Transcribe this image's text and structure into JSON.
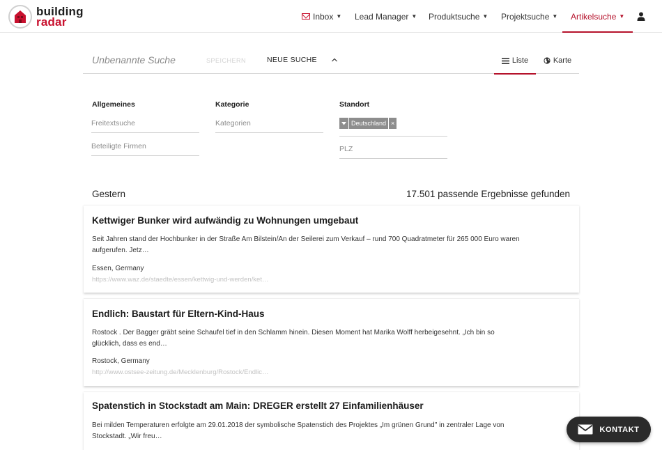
{
  "brand": {
    "line1": "building",
    "line2": "radar",
    "colors": {
      "red": "#c8102e",
      "accent": "#b5122b",
      "dark": "#2b2b2b"
    }
  },
  "nav": {
    "items": [
      {
        "label": "Inbox",
        "icon": "envelope-icon"
      },
      {
        "label": "Lead Manager"
      },
      {
        "label": "Produktsuche"
      },
      {
        "label": "Projektsuche"
      },
      {
        "label": "Artikelsuche",
        "active": true
      }
    ],
    "user_icon": "user-icon"
  },
  "search": {
    "title": "Unbenannte Suche",
    "save_label": "SPEICHERN",
    "new_label": "NEUE SUCHE",
    "views": {
      "list": "Liste",
      "map": "Karte"
    }
  },
  "filters": {
    "general": {
      "title": "Allgemeines",
      "freetext_placeholder": "Freitextsuche",
      "companies_placeholder": "Beteiligte Firmen"
    },
    "category": {
      "title": "Kategorie",
      "placeholder": "Kategorien"
    },
    "location": {
      "title": "Standort",
      "tag": "Deutschland",
      "plz_placeholder": "PLZ"
    }
  },
  "results": {
    "day": "Gestern",
    "count_text": "17.501 passende Ergebnisse gefunden",
    "items": [
      {
        "title": "Kettwiger Bunker wird aufwändig zu Wohnungen umgebaut",
        "text": "Seit Jahren stand der Hochbunker in der Straße Am Bilstein/An der Seilerei zum Verkauf – rund 700 Quadratmeter für 265 000 Euro waren aufgerufen. Jetz…",
        "location": "Essen, Germany",
        "url": "https://www.waz.de/staedte/essen/kettwig-und-werden/ket…"
      },
      {
        "title": "Endlich: Baustart für Eltern-Kind-Haus",
        "text": "Rostock . Der Bagger gräbt seine Schaufel tief in den Schlamm hinein. Diesen Moment hat Marika Wolff herbeigesehnt. „Ich bin so glücklich, dass es end…",
        "location": "Rostock, Germany",
        "url": "http://www.ostsee-zeitung.de/Mecklenburg/Rostock/Endlic…"
      },
      {
        "title": "Spatenstich in Stockstadt am Main: DREGER erstellt 27 Einfamilienhäuser",
        "text": "Bei milden Temperaturen erfolgte am 29.01.2018 der symbolische Spatenstich des Projektes „Im grünen Grund\" in zentraler Lage von Stockstadt. „Wir freu…",
        "location": "",
        "url": ""
      }
    ]
  },
  "contact": {
    "label": "KONTAKT"
  }
}
